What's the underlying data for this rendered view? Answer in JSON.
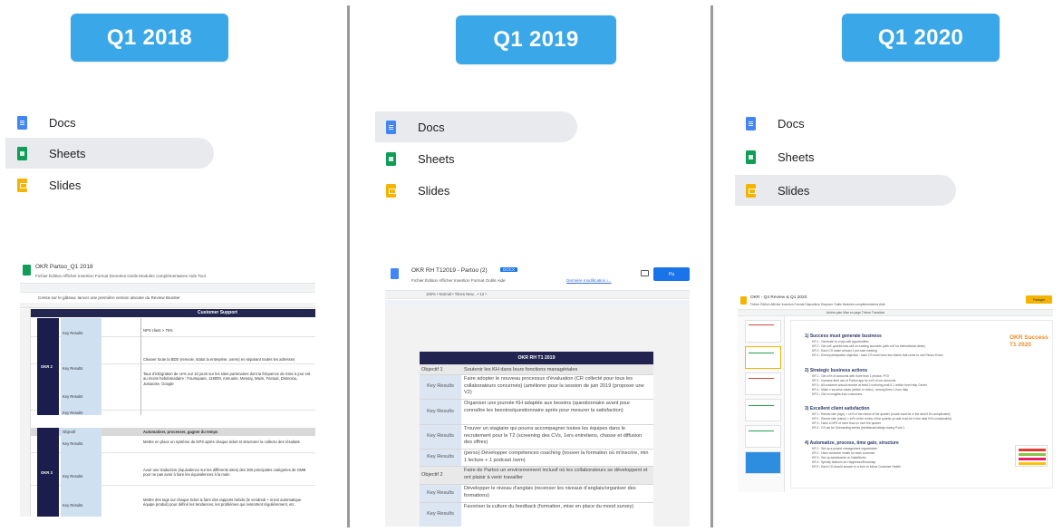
{
  "columns": [
    {
      "quarter_label": "Q1 2018",
      "apps": [
        "Docs",
        "Sheets",
        "Slides"
      ],
      "selected_app": "Sheets",
      "file": {
        "title": "OKR Partoo_Q1 2018",
        "menu": "Fichier  Édition  Afficher  Insertion  Format  Données  Outils  Modules complémentaires  Aide  Tout",
        "formula_text": "Cerise sur le gâteau: lancer une première version aboutie du Review Booster",
        "section1_header": "Customer Support",
        "okr1_label": "OKR 2",
        "okr2_label": "OKR 3",
        "key_results_label": "Key Results",
        "objectif_label": "Objectif",
        "kr_texts": [
          "NPS client > 75%",
          "Cleaner toute la BDD (renvoie, statut la entreprise, users) en séparant toutes les adresses",
          "Taux d'intégration de ce% our 10 jours sur les sites partenaires dont la fréquence de mise à jour est au moins hebdomadaire : Foursquare, 118000, Annuaire, Mensaj, Waze, Factual, Dismoiou, Justacote, Google"
        ],
        "section2_header": "Automatiser, processer, gagner du temps",
        "kr_texts_2": [
          "Mettre en place un système de NPS après chaque ticket et structurer la collecte des résultats",
          "Avoir une traduction (équivalence sur les différents sites) des 300 principales catégories de GMB pour ne pas avoir à faire les équivalences à la main",
          "Mettre des tags sur chaque ticket & faire des rapports hebdo (le vendredi + envoi automatique équipe produit) pour définir les tendances, les problèmes qui ressortent régulièrement, etc."
        ]
      }
    },
    {
      "quarter_label": "Q1 2019",
      "apps": [
        "Docs",
        "Sheets",
        "Slides"
      ],
      "selected_app": "Docs",
      "file": {
        "title": "OKR RH T12019 - Partoo (2)",
        "badge": "DOCX",
        "menu": "Fichier  Édition  Afficher  Insertion  Format  Outils  Aide",
        "last_edit": "Dernière modification i...",
        "toolbar_text": "100%  •  Normal  •  Times New...  •  12  •",
        "share_label": "Pa",
        "table_title": "OKR RH T1 2019",
        "rows": [
          {
            "left": "Objectif 1",
            "right": "Soutenir les KH dans leurs fonctions managériales",
            "kind": "obj"
          },
          {
            "left": "Key Results",
            "right": "Faire adopter le nouveau processus d'évaluation (CR collecté pour tous les collaborateurs concernés) (améliorer pour la session de juin 2019 (proposer une V2)",
            "kind": "kr"
          },
          {
            "left": "Key Results",
            "right": "Organiser une journée KH adaptée aux besoins (questionnaire avant pour connaître les besoins/questionnaire après pour mesurer la satisfaction)",
            "kind": "kr"
          },
          {
            "left": "Key Results",
            "right": "Trouver un stagiaire qui pourra accompagner toutes les équipes dans le recrutement pour le T2 (screening des CVs, 1ers entretiens, chasse et diffusion des offres)",
            "kind": "kr"
          },
          {
            "left": "Key Results",
            "right": "(perso) Développer compétences coaching (trouver la formation où m'inscrire, min 1 lecture + 1 podcast /sem)",
            "kind": "kr"
          },
          {
            "left": "Objectif 2",
            "right": "Faire de Partoo un environnement inclusif où les collaborateurs se développent et ont plaisir à venir travailler",
            "kind": "obj"
          },
          {
            "left": "Key Results",
            "right": "Développer le niveau d'anglais (recenser les niveaux d'anglais/organiser des formations)",
            "kind": "kr"
          },
          {
            "left": "Key Results",
            "right": "Favoriser la culture du feedback (formation, mise en place du mood survey)",
            "kind": "kr"
          }
        ]
      }
    },
    {
      "quarter_label": "Q1 2020",
      "apps": [
        "Docs",
        "Sheets",
        "Slides"
      ],
      "selected_app": "Slides",
      "file": {
        "title": "OKR - Q4 Review & Q1 2020",
        "menu": "Fichier  Édition  Afficher  Insertion  Format  Diapositive  Disposer  Outils  Modules complémentaires  Aide",
        "toolbar_text": "Arrière-plan   Mise en page   Thème   Transition",
        "share_label": "Partager",
        "slide_badge": "OKR Success T1 2020",
        "sections": [
          {
            "heading": "1) Success must generate business",
            "bullets": [
              "KR 1 : Generate xx cross-sell opportunities",
              "KR 2 : Get xxK upsell/cross-sell on existing accounts (with xxK for international deals)",
              "KR 3 : Each CS make at least 1 pre-sale meeting",
              "KR 4 : Event participation objective : each CS must have two clients that come to one Partoo Event"
            ]
          },
          {
            "heading": "2) Strategic business actions",
            "bullets": [
              "KR 1 : Get xx% of accounts with more than 1 photos / POI",
              "KR 2 : Increase feed use of Partoo app for xx% of our accounts",
              "KR 3 : All customer should receive at least 2 nurturing mail & 1 article from Help Center",
              "KR 4 : Make x success cases (article or video) : among them 1 from Italy",
              "KR 5 : Get xx insights from customers"
            ]
          },
          {
            "heading": "3) Excellent client satisfaction",
            "bullets": [
              "KR 1 : Renew rate (logo) > xx% of the renew of the quarter (a sale must be in the deal if it's complicated)",
              "KR 2 : Renew rate (value) > xx% of the renew of the quarter (a sale must be in the deal if it's complicated)",
              "KR 3 : Have a NPS of more than xx over the quarter",
              "KR 4 : CS set for Onboarding weeks (feedbacks/ratings during Point 1"
            ]
          },
          {
            "heading": "4) Automatize, process, time gain, structure",
            "bullets": [
              "KR 1 : Set up a project management organization",
              "KR 2 : Have customer health for each customer",
              "KR 3 : Set up dashboards on DataStudio",
              "KR 4 : Specify features for Happiness/Roadmap",
              "KR 5 : Each CS should answer to a form to follow Customer Health"
            ]
          }
        ]
      }
    }
  ],
  "colors": {
    "quarter_button": "#3aa7e8",
    "docs": "#4285f4",
    "sheets": "#0f9d58",
    "slides": "#f4b400",
    "okr_dark": "#1b1d4d",
    "accent_orange": "#f08a24"
  }
}
